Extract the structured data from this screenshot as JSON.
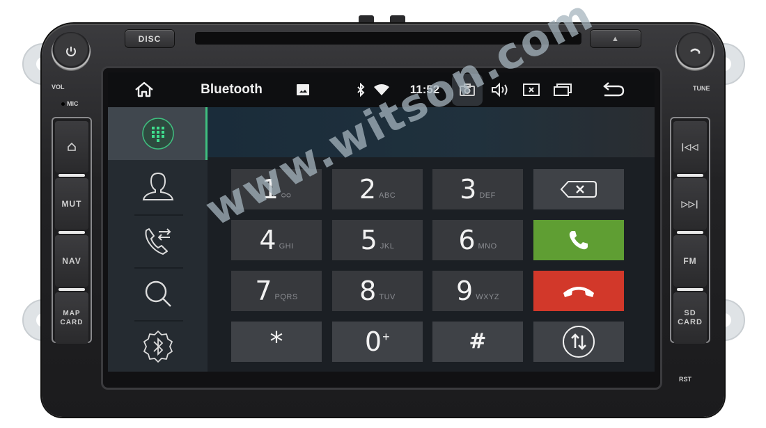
{
  "device": {
    "disc_button": "DISC",
    "eject_button": "▲",
    "power_knob_label": "VOL",
    "tune_knob_label": "TUNE",
    "mic_label": "MIC",
    "rst_label": "RST",
    "left_buttons": [
      {
        "label": "⌂",
        "name": "home"
      },
      {
        "label": "MUT",
        "name": "mute"
      },
      {
        "label": "NAV",
        "name": "nav"
      },
      {
        "label": "MAP\nCARD",
        "name": "map-card"
      }
    ],
    "right_buttons": [
      {
        "label": "|◁◁",
        "name": "previous"
      },
      {
        "label": "▷▷|",
        "name": "next"
      },
      {
        "label": "FM",
        "name": "fm"
      },
      {
        "label": "SD\nCARD",
        "name": "sd-card"
      }
    ]
  },
  "statusbar": {
    "title": "Bluetooth",
    "time": "11:52",
    "icons": [
      "home-icon",
      "image-icon",
      "bluetooth-icon",
      "wifi-icon",
      "camera-icon",
      "volume-icon",
      "close-window-icon",
      "recent-apps-icon",
      "back-icon"
    ]
  },
  "sidebar": {
    "items": [
      {
        "name": "dialpad",
        "icon": "dialpad-icon",
        "active": true
      },
      {
        "name": "contacts",
        "icon": "contact-icon",
        "active": false
      },
      {
        "name": "call-log",
        "icon": "call-log-icon",
        "active": false
      },
      {
        "name": "search",
        "icon": "search-icon",
        "active": false
      },
      {
        "name": "bt-settings",
        "icon": "bluetooth-settings-icon",
        "active": false
      }
    ]
  },
  "dialer": {
    "number_display": "",
    "keys": [
      {
        "digit": "1",
        "letters": "ᴑᴑ"
      },
      {
        "digit": "2",
        "letters": "ABC"
      },
      {
        "digit": "3",
        "letters": "DEF"
      },
      {
        "digit": "4",
        "letters": "GHI"
      },
      {
        "digit": "5",
        "letters": "JKL"
      },
      {
        "digit": "6",
        "letters": "MNO"
      },
      {
        "digit": "7",
        "letters": "PQRS"
      },
      {
        "digit": "8",
        "letters": "TUV"
      },
      {
        "digit": "9",
        "letters": "WXYZ"
      },
      {
        "digit": "*",
        "letters": ""
      },
      {
        "digit": "0",
        "letters": "+"
      },
      {
        "digit": "#",
        "letters": ""
      }
    ],
    "actions": [
      "backspace",
      "call",
      "end-call",
      "transfer"
    ],
    "colors": {
      "call": "#5f9e33",
      "end": "#d2382a",
      "accent": "#3fbf7f"
    }
  },
  "watermark": "www.witson.com"
}
